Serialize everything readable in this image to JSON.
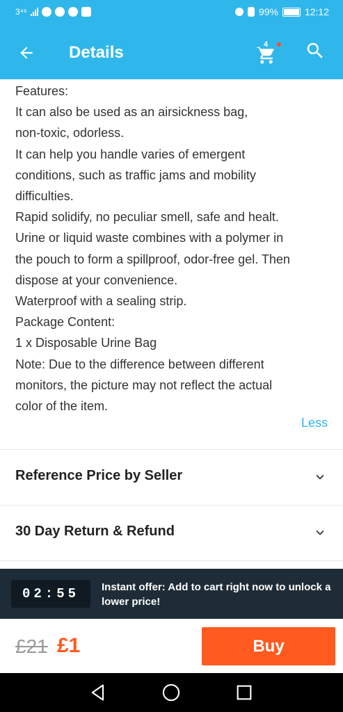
{
  "status_bar": {
    "network": "3⁴⁶",
    "battery_pct": "99%",
    "time": "12:12"
  },
  "app_bar": {
    "title": "Details",
    "cart_count": "4",
    "icons": {
      "back": "arrow-back-icon",
      "cart": "cart-icon",
      "search": "search-icon"
    }
  },
  "description": {
    "lines": [
      "Features:",
      "It can also be used as an airsickness bag,",
      "non-toxic, odorless.",
      "It can help you handle varies of emergent",
      "conditions, such as traffic jams and mobility",
      "difficulties.",
      "Rapid solidify, no peculiar smell, safe and healt.",
      "Urine or liquid waste combines with a polymer in",
      "the pouch to form a spillproof, odor-free gel. Then",
      "dispose at your convenience.",
      "Waterproof with a sealing strip.",
      "Package Content:",
      "1 x Disposable Urine Bag",
      "Note: Due to the difference between different",
      "monitors, the picture may not reflect the actual",
      "color of the item."
    ],
    "less_label": "Less"
  },
  "sections": [
    {
      "label": "Reference Price by Seller"
    },
    {
      "label": "30 Day Return & Refund"
    }
  ],
  "offer": {
    "timer": "02:55",
    "text": "Instant offer: Add to cart right now to unlock a lower price!"
  },
  "purchase": {
    "old_price": "£21",
    "new_price": "£1",
    "buy_label": "Buy"
  },
  "colors": {
    "primary": "#2fb7ec",
    "accent": "#ff5a1f",
    "banner": "#1e2c37"
  }
}
